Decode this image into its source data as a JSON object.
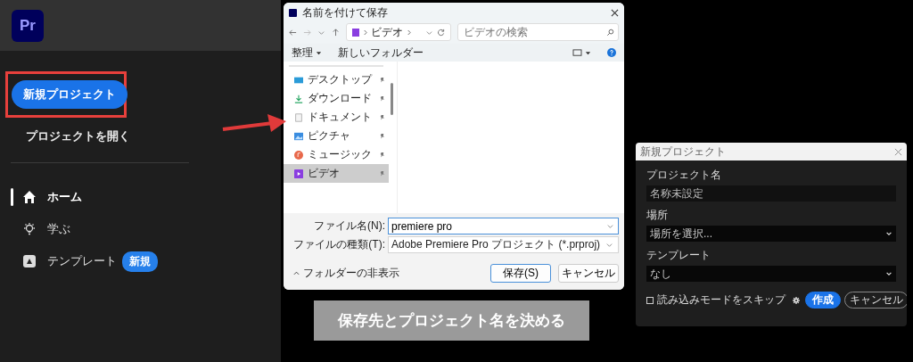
{
  "sidebar": {
    "logo": "Pr",
    "new_project_button": "新規プロジェクト",
    "open_project_link": "プロジェクトを開く",
    "nav_items": [
      {
        "label": "ホーム",
        "selected": true
      },
      {
        "label": "学ぶ",
        "selected": false
      },
      {
        "label": "テンプレート",
        "selected": false,
        "badge": "新規"
      }
    ]
  },
  "save_dialog": {
    "title": "名前を付けて保存",
    "breadcrumb": "ビデオ",
    "search": {
      "placeholder": "ビデオの検索"
    },
    "toolbar": [
      "整理",
      "新しいフォルダー"
    ],
    "nav_items": [
      {
        "label": "デスクトップ",
        "selected": false
      },
      {
        "label": "ダウンロード",
        "selected": false
      },
      {
        "label": "ドキュメント",
        "selected": false
      },
      {
        "label": "ピクチャ",
        "selected": false
      },
      {
        "label": "ミュージック",
        "selected": false
      },
      {
        "label": "ビデオ",
        "selected": true
      }
    ],
    "file_name": {
      "label": "ファイル名(N):",
      "value": "premiere pro"
    },
    "file_type": {
      "label": "ファイルの種類(T):",
      "value": "Adobe Premiere Pro プロジェクト (*.prproj)"
    },
    "hide_folders": "フォルダーの非表示",
    "buttons": [
      "保存(S)",
      "キャンセル"
    ]
  },
  "caption": "保存先とプロジェクト名を決める",
  "new_project_dialog": {
    "title": "新規プロジェクト",
    "fields": [
      {
        "kind": "text",
        "label": "プロジェクト名",
        "placeholder": "名称未設定"
      },
      {
        "kind": "select",
        "label": "場所",
        "value": "場所を選択..."
      },
      {
        "kind": "select",
        "label": "テンプレート",
        "value": "なし"
      }
    ],
    "skip_import": {
      "label": "読み込みモードをスキップ",
      "checked": false
    },
    "buttons": [
      "作成",
      "キャンセル"
    ]
  }
}
